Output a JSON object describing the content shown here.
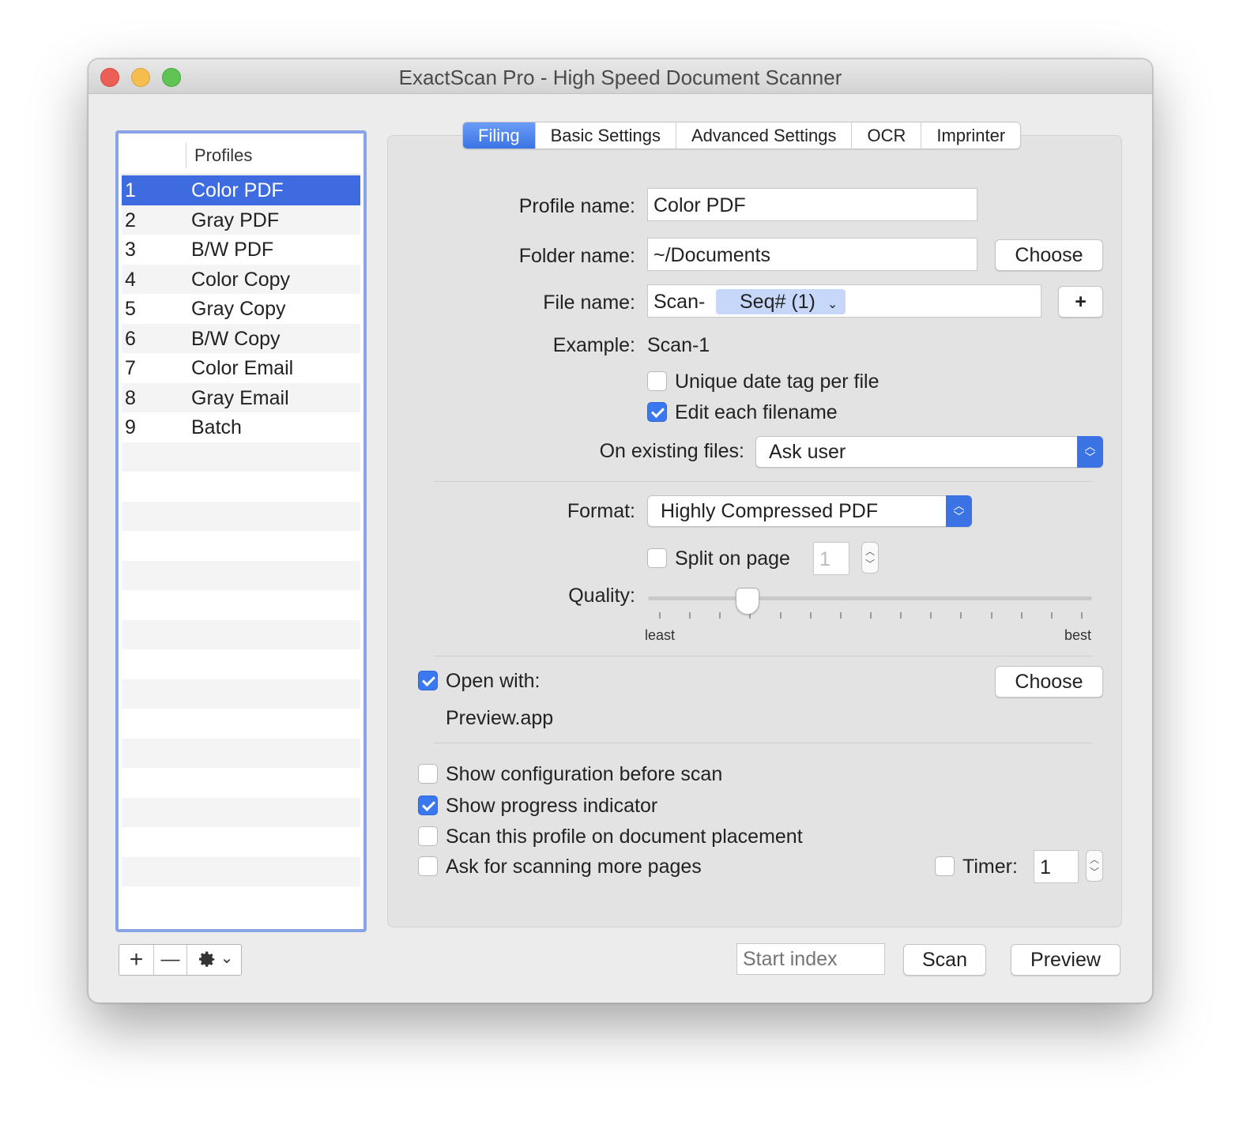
{
  "window": {
    "title": "ExactScan Pro - High Speed Document Scanner"
  },
  "sidebar": {
    "header": "Profiles",
    "profiles": [
      {
        "num": "1",
        "name": "Color PDF"
      },
      {
        "num": "2",
        "name": "Gray PDF"
      },
      {
        "num": "3",
        "name": "B/W PDF"
      },
      {
        "num": "4",
        "name": "Color Copy"
      },
      {
        "num": "5",
        "name": "Gray Copy"
      },
      {
        "num": "6",
        "name": "B/W Copy"
      },
      {
        "num": "7",
        "name": "Color Email"
      },
      {
        "num": "8",
        "name": "Gray Email"
      },
      {
        "num": "9",
        "name": "Batch"
      }
    ],
    "selected_index": 0,
    "toolbar": {
      "add": "+",
      "remove": "—",
      "gear_caret": "⌄"
    }
  },
  "tabs": [
    {
      "label": "Filing",
      "active": true
    },
    {
      "label": "Basic Settings",
      "active": false
    },
    {
      "label": "Advanced Settings",
      "active": false
    },
    {
      "label": "OCR",
      "active": false
    },
    {
      "label": "Imprinter",
      "active": false
    }
  ],
  "filing": {
    "profile_name_label": "Profile name:",
    "profile_name_value": "Color PDF",
    "folder_name_label": "Folder name:",
    "folder_name_value": "~/Documents",
    "folder_choose": "Choose",
    "file_name_label": "File name:",
    "file_name_prefix": "Scan-",
    "file_name_token": "Seq# (1)",
    "file_name_add": "+",
    "example_label": "Example:",
    "example_value": "Scan-1",
    "unique_date_tag": {
      "label": "Unique date tag per file",
      "checked": false
    },
    "edit_each_filename": {
      "label": "Edit each filename",
      "checked": true
    },
    "on_existing_label": "On existing files:",
    "on_existing_value": "Ask user",
    "format_label": "Format:",
    "format_value": "Highly Compressed PDF",
    "split_on_page": {
      "label": "Split on page",
      "checked": false,
      "value": "1"
    },
    "quality_label": "Quality:",
    "quality_min": "least",
    "quality_max": "best",
    "quality_fraction": 0.21,
    "open_with": {
      "label": "Open with:",
      "checked": true,
      "app": "Preview.app",
      "choose": "Choose"
    },
    "show_config": {
      "label": "Show configuration before scan",
      "checked": false
    },
    "show_progress": {
      "label": "Show progress indicator",
      "checked": true
    },
    "scan_on_placement": {
      "label": "Scan this profile on document placement",
      "checked": false
    },
    "ask_more_pages": {
      "label": "Ask for scanning more pages",
      "checked": false
    },
    "timer": {
      "label": "Timer:",
      "checked": false,
      "value": "1"
    }
  },
  "footer": {
    "start_index_placeholder": "Start index",
    "scan_button": "Scan",
    "preview_button": "Preview"
  },
  "colors": {
    "accent": "#3b73e4",
    "selection": "#3e6ce0",
    "sidebar_focus": "#88a3e6"
  }
}
